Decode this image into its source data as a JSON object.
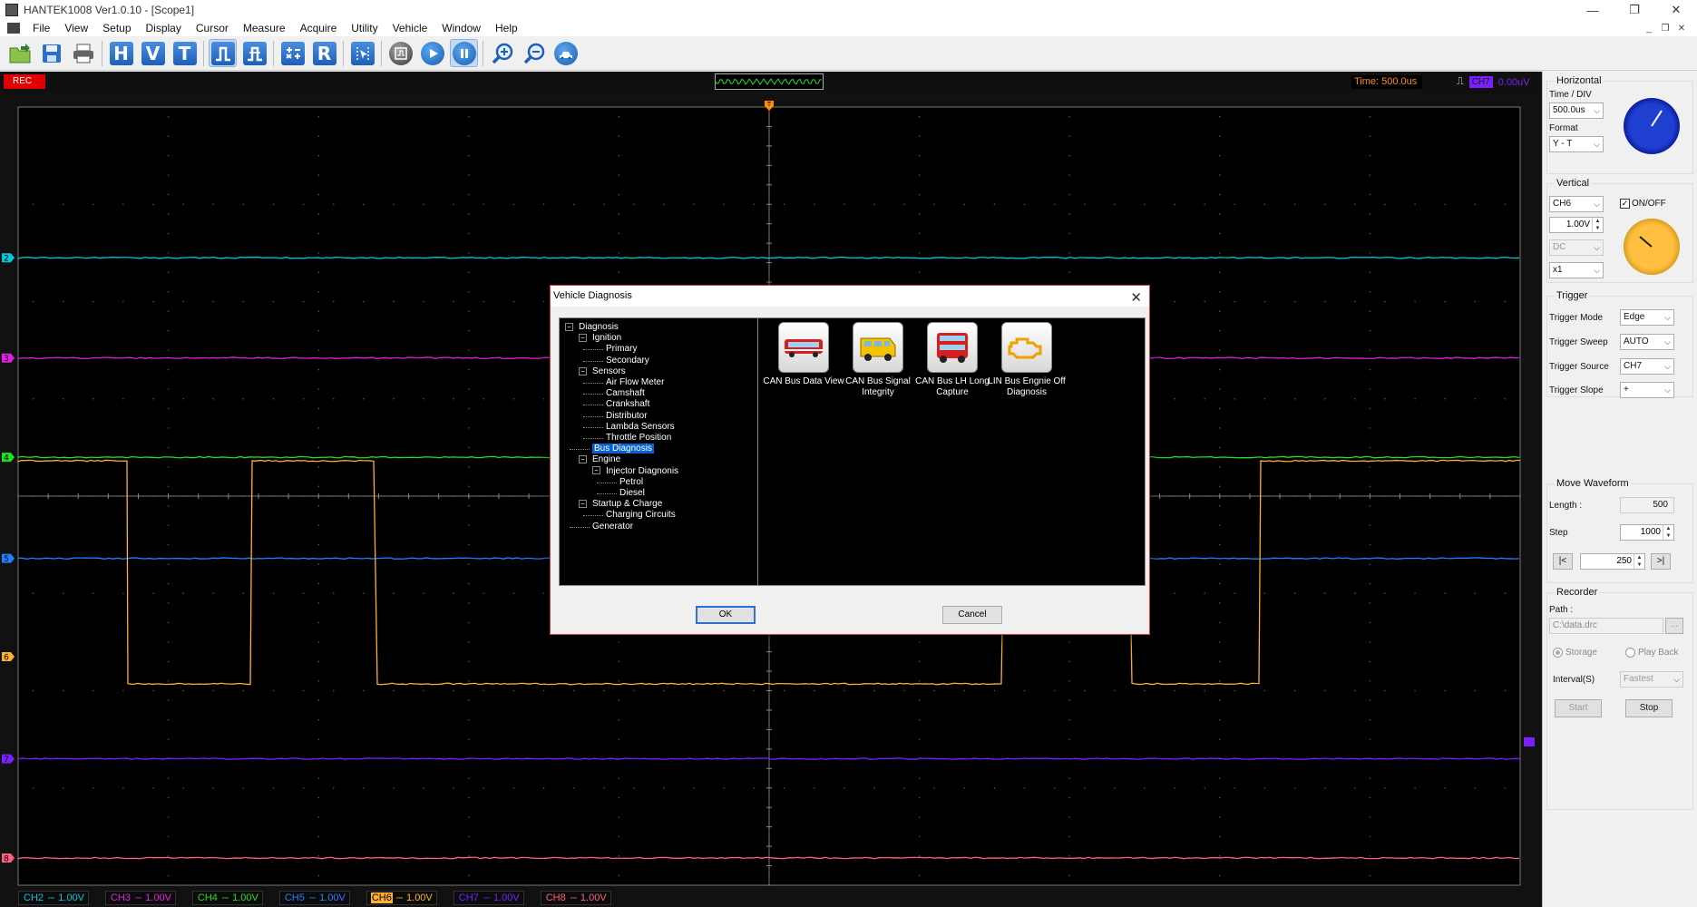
{
  "window": {
    "title": "HANTEK1008 Ver1.0.10 - [Scope1]",
    "controls": [
      "—",
      "❐",
      "✕"
    ],
    "mdi_controls": [
      "_",
      "❐",
      "✕"
    ]
  },
  "menu": [
    "File",
    "View",
    "Setup",
    "Display",
    "Cursor",
    "Measure",
    "Acquire",
    "Utility",
    "Vehicle",
    "Window",
    "Help"
  ],
  "toolbar": {
    "letters": [
      "H",
      "V",
      "T",
      "R"
    ]
  },
  "scope": {
    "rec_label": "REC",
    "time_readout": "Time: 500.0us",
    "trigger_channel": "CH7",
    "trigger_level": "0.00uV",
    "channel_markers": [
      "2",
      "3",
      "4",
      "5",
      "6",
      "7",
      "8"
    ],
    "trigger_marker": "T"
  },
  "channels": [
    {
      "name": "CH2",
      "coupling": "⎓",
      "volts": "1.00V",
      "color": "#00c8d8"
    },
    {
      "name": "CH3",
      "coupling": "⎓",
      "volts": "1.00V",
      "color": "#e020e0"
    },
    {
      "name": "CH4",
      "coupling": "⎓",
      "volts": "1.00V",
      "color": "#20e020"
    },
    {
      "name": "CH5",
      "coupling": "⎓",
      "volts": "1.00V",
      "color": "#2080ff"
    },
    {
      "name": "CH6",
      "coupling": "⎓",
      "volts": "1.00V",
      "color": "#ffb030"
    },
    {
      "name": "CH7",
      "coupling": "⎓",
      "volts": "1.00V",
      "color": "#7b1fff"
    },
    {
      "name": "CH8",
      "coupling": "⎓",
      "volts": "1.00V",
      "color": "#ff6080"
    }
  ],
  "panel": {
    "horizontal": {
      "title": "Horizontal",
      "time_div_label": "Time / DIV",
      "time_div_value": "500.0us",
      "format_label": "Format",
      "format_value": "Y - T"
    },
    "vertical": {
      "title": "Vertical",
      "channel_value": "CH6",
      "onoff_label": "ON/OFF",
      "volts_value": "1.00V",
      "coupling_value": "DC",
      "probe_value": "x1"
    },
    "trigger": {
      "title": "Trigger",
      "mode_label": "Trigger Mode",
      "mode_value": "Edge",
      "sweep_label": "Trigger Sweep",
      "sweep_value": "AUTO",
      "source_label": "Trigger Source",
      "source_value": "CH7",
      "slope_label": "Trigger Slope",
      "slope_value": "+"
    },
    "move": {
      "title": "Move Waveform",
      "length_label": "Length :",
      "length_value": "500",
      "step_label": "Step",
      "step_value": "1000",
      "first_label": "|<",
      "pos_value": "250",
      "last_label": ">|"
    },
    "recorder": {
      "title": "Recorder",
      "path_label": "Path :",
      "path_value": "C:\\data.drc",
      "browse_label": "...",
      "storage_label": "Storage",
      "playback_label": "Play Back",
      "interval_label": "Interval(S)",
      "interval_value": "Fastest",
      "start_label": "Start",
      "stop_label": "Stop"
    }
  },
  "dialog": {
    "title": "Vehicle Diagnosis",
    "tree": [
      {
        "label": "Diagnosis",
        "level": 0,
        "toggle": "−"
      },
      {
        "label": "Ignition",
        "level": 1,
        "toggle": "−"
      },
      {
        "label": "Primary",
        "level": 2
      },
      {
        "label": "Secondary",
        "level": 2
      },
      {
        "label": "Sensors",
        "level": 1,
        "toggle": "−"
      },
      {
        "label": "Air Flow Meter",
        "level": 2
      },
      {
        "label": "Camshaft",
        "level": 2
      },
      {
        "label": "Crankshaft",
        "level": 2
      },
      {
        "label": "Distributor",
        "level": 2
      },
      {
        "label": "Lambda Sensors",
        "level": 2
      },
      {
        "label": "Throttle Position",
        "level": 2
      },
      {
        "label": "Bus Diagnosis",
        "level": 1,
        "selected": true
      },
      {
        "label": "Engine",
        "level": 1,
        "toggle": "−"
      },
      {
        "label": "Injector Diagnonis",
        "level": 2,
        "toggle": "−"
      },
      {
        "label": "Petrol",
        "level": 3
      },
      {
        "label": "Diesel",
        "level": 3
      },
      {
        "label": "Startup & Charge",
        "level": 1,
        "toggle": "−"
      },
      {
        "label": "Charging Circuits",
        "level": 2
      },
      {
        "label": "Generator",
        "level": 1
      }
    ],
    "functions": [
      {
        "line1": "CAN Bus Data View",
        "line2": ""
      },
      {
        "line1": "CAN Bus Signal",
        "line2": "Integrity"
      },
      {
        "line1": "CAN Bus LH Long",
        "line2": "Capture"
      },
      {
        "line1": "LIN Bus Engnie Off",
        "line2": "Diagnosis"
      }
    ],
    "ok_label": "OK",
    "cancel_label": "Cancel"
  }
}
